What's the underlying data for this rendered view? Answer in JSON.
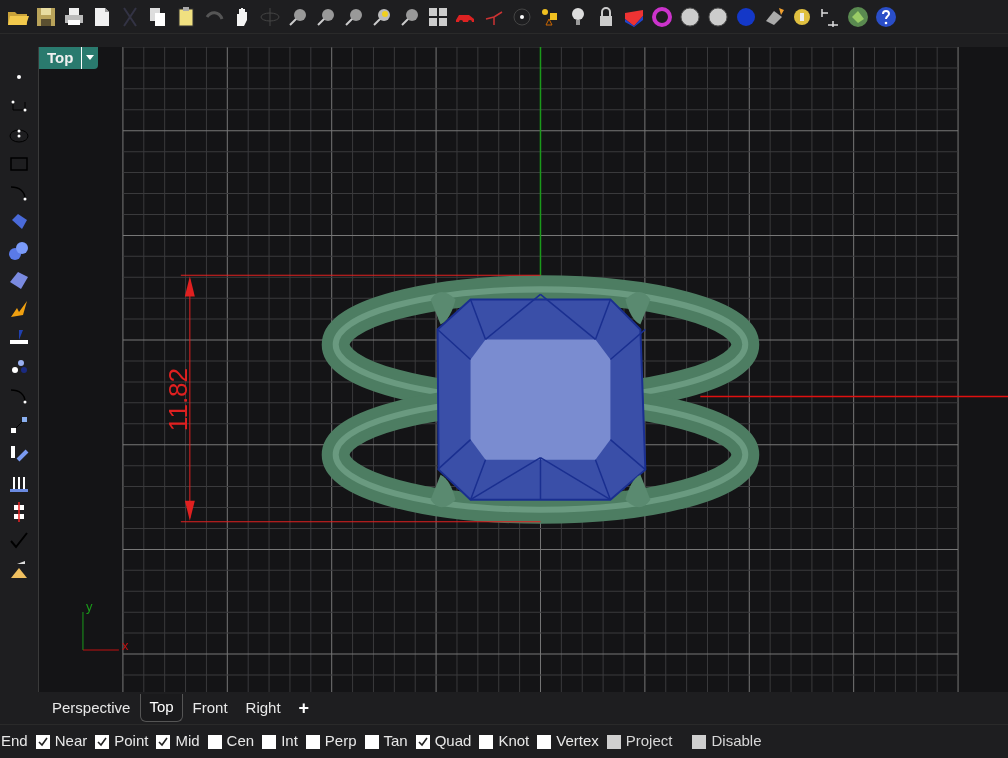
{
  "viewport": {
    "title": "Top",
    "dimension": "11.82",
    "axis_y": "y",
    "axis_x": "x"
  },
  "view_tabs": [
    {
      "label": "Perspective",
      "selected": false
    },
    {
      "label": "Top",
      "selected": true
    },
    {
      "label": "Front",
      "selected": false
    },
    {
      "label": "Right",
      "selected": false
    }
  ],
  "add_tab": "+",
  "osnaps": [
    {
      "label": "End",
      "kind": "label"
    },
    {
      "label": "Near",
      "kind": "check",
      "checked": true,
      "disabled": false
    },
    {
      "label": "Point",
      "kind": "check",
      "checked": true,
      "disabled": false
    },
    {
      "label": "Mid",
      "kind": "check",
      "checked": true,
      "disabled": false
    },
    {
      "label": "Cen",
      "kind": "check",
      "checked": false,
      "disabled": false
    },
    {
      "label": "Int",
      "kind": "check",
      "checked": false,
      "disabled": false
    },
    {
      "label": "Perp",
      "kind": "check",
      "checked": false,
      "disabled": false
    },
    {
      "label": "Tan",
      "kind": "check",
      "checked": false,
      "disabled": false
    },
    {
      "label": "Quad",
      "kind": "check",
      "checked": true,
      "disabled": false
    },
    {
      "label": "Knot",
      "kind": "check",
      "checked": false,
      "disabled": false
    },
    {
      "label": "Vertex",
      "kind": "check",
      "checked": false,
      "disabled": false
    },
    {
      "label": "Project",
      "kind": "check",
      "checked": false,
      "disabled": true
    },
    {
      "label": "Disable",
      "kind": "check",
      "checked": false,
      "disabled": true
    }
  ]
}
